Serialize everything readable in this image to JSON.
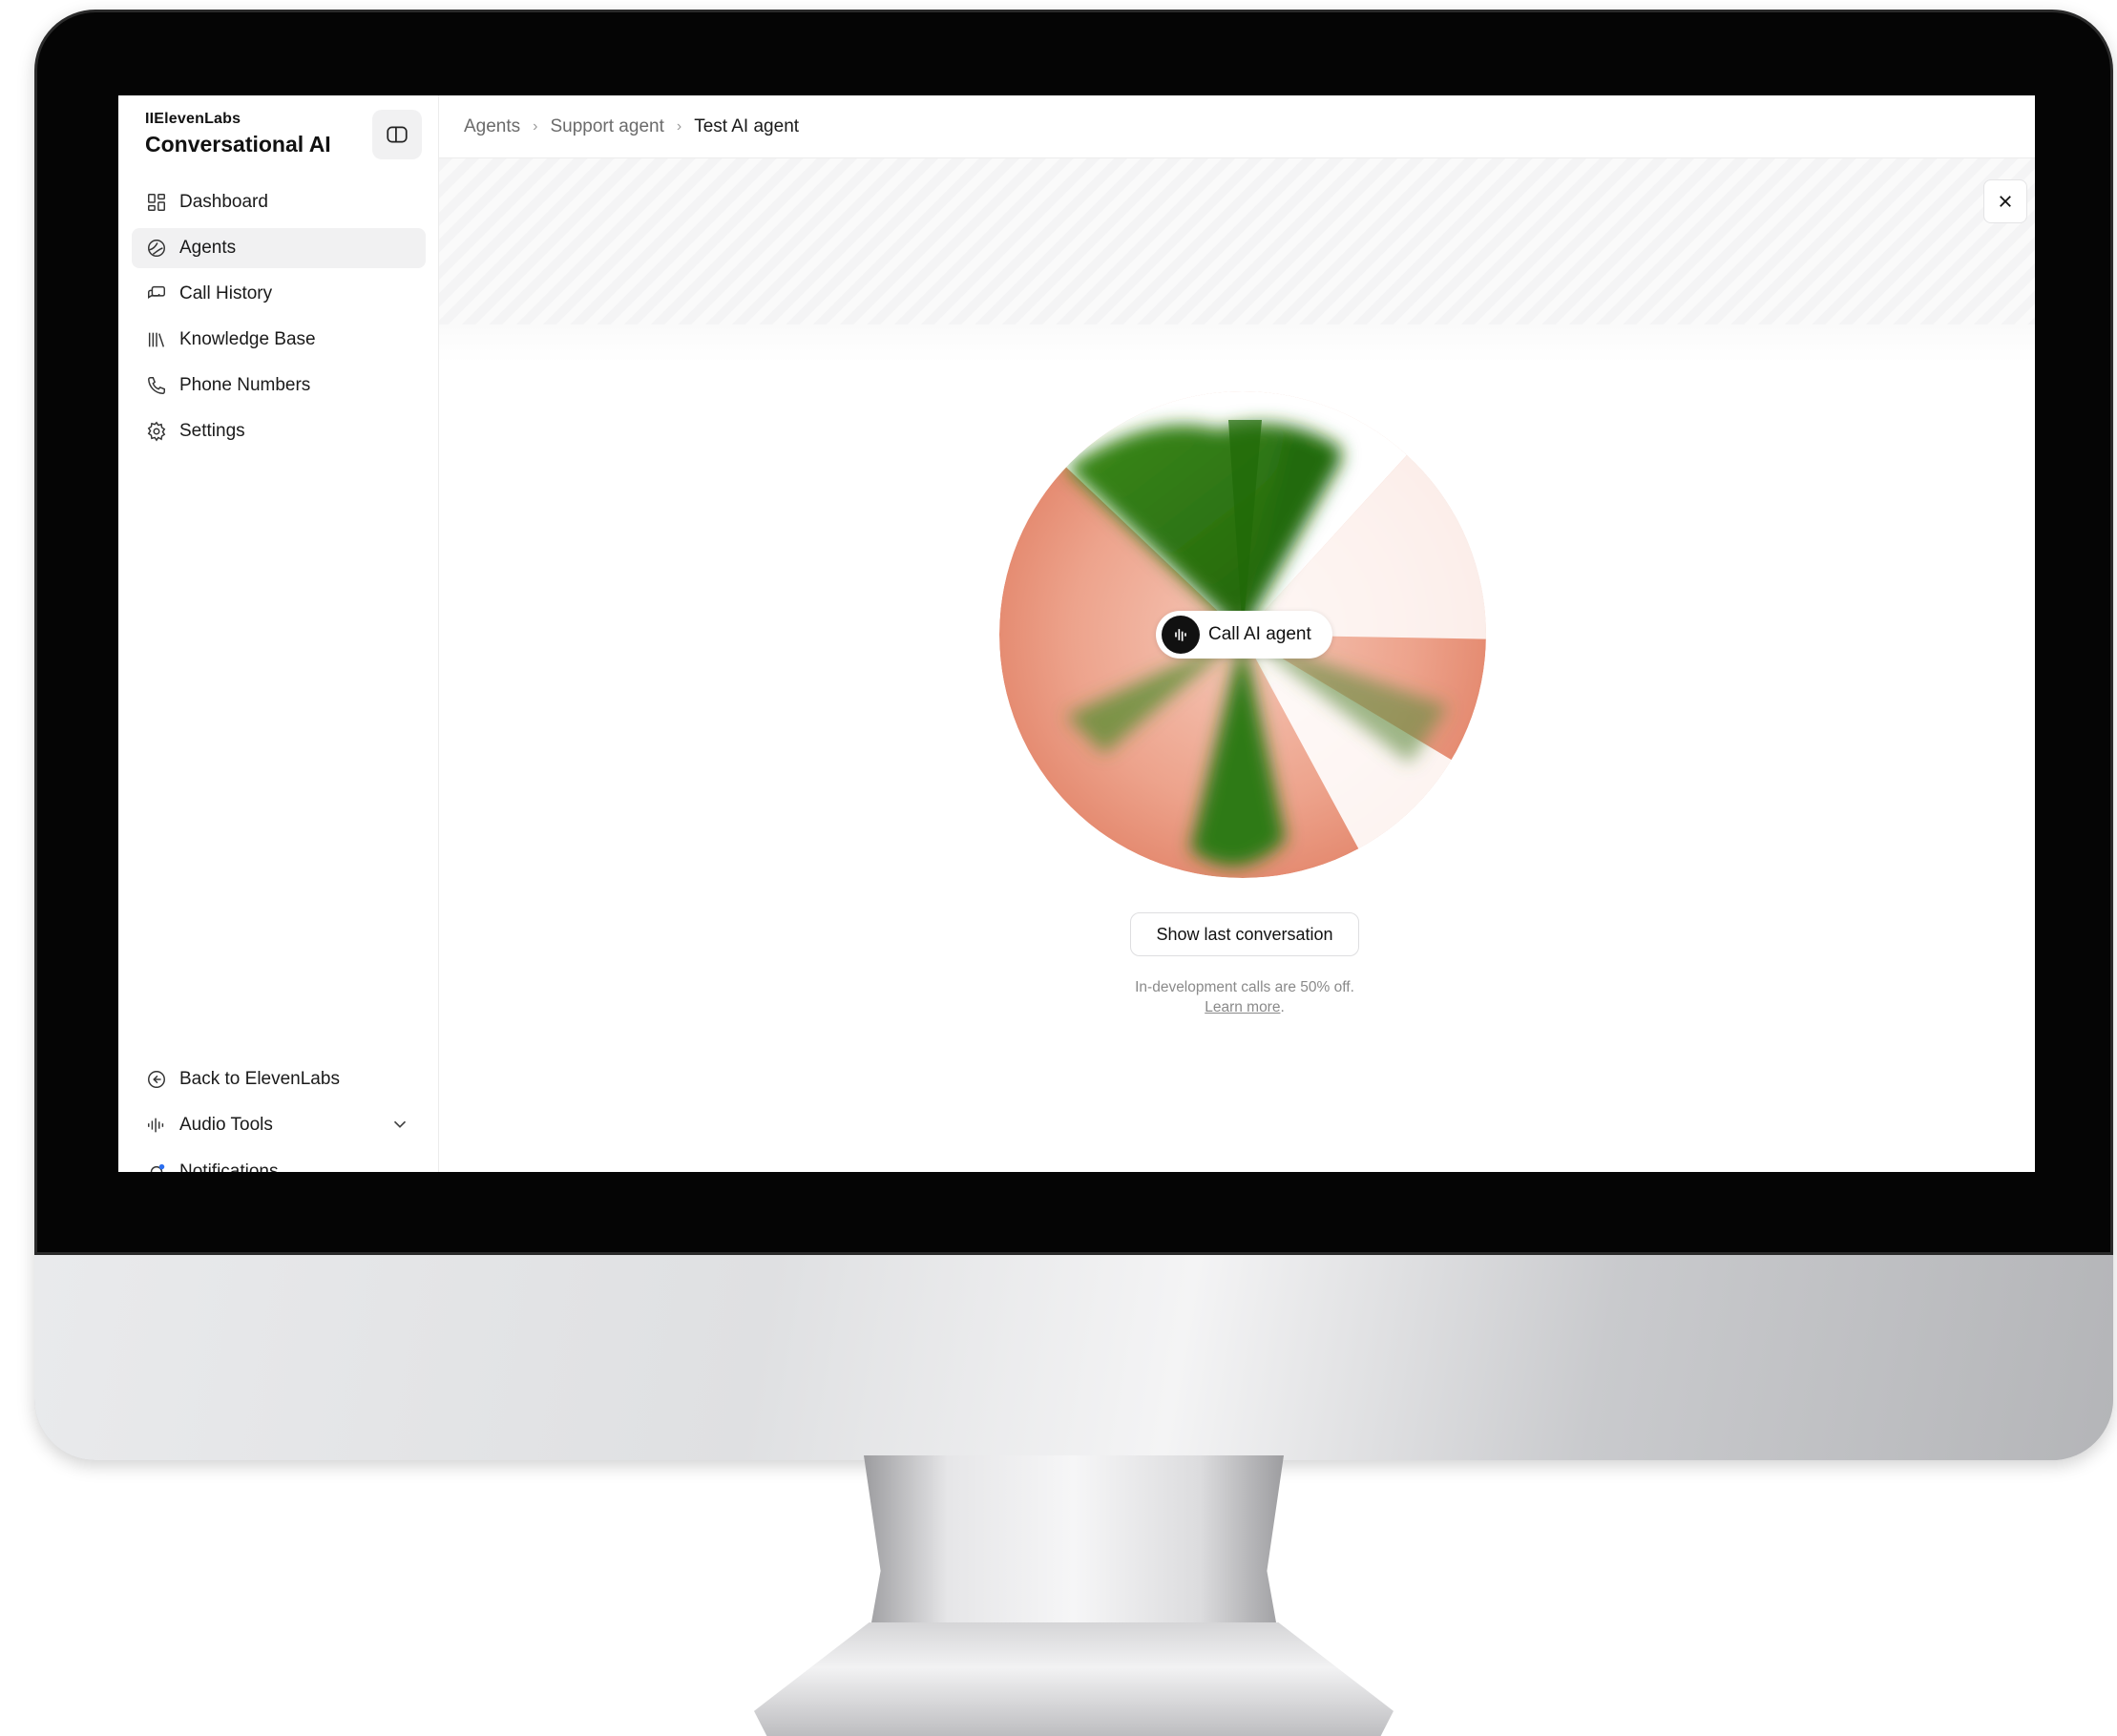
{
  "brand": {
    "small": "IIElevenLabs",
    "title": "Conversational AI"
  },
  "sidebar": {
    "items": [
      {
        "label": "Dashboard",
        "icon": "dashboard-icon"
      },
      {
        "label": "Agents",
        "icon": "agents-icon",
        "active": true
      },
      {
        "label": "Call History",
        "icon": "call-history-icon"
      },
      {
        "label": "Knowledge Base",
        "icon": "knowledge-base-icon"
      },
      {
        "label": "Phone Numbers",
        "icon": "phone-icon"
      },
      {
        "label": "Settings",
        "icon": "gear-icon"
      }
    ],
    "bottom": [
      {
        "label": "Back to ElevenLabs",
        "icon": "arrow-left-circle-icon"
      },
      {
        "label": "Audio Tools",
        "icon": "waveform-icon"
      },
      {
        "label": "Notifications",
        "icon": "bell-icon"
      }
    ]
  },
  "breadcrumb": [
    "Agents",
    "Support agent",
    "Test AI agent"
  ],
  "main": {
    "call_button": "Call AI agent",
    "show_last": "Show last conversation",
    "note": "In-development calls are 50% off.",
    "learn_more": "Learn more"
  },
  "colors": {
    "orb_green": "#2f7a12",
    "orb_salmon": "#e89880",
    "accent_dark": "#111111"
  }
}
